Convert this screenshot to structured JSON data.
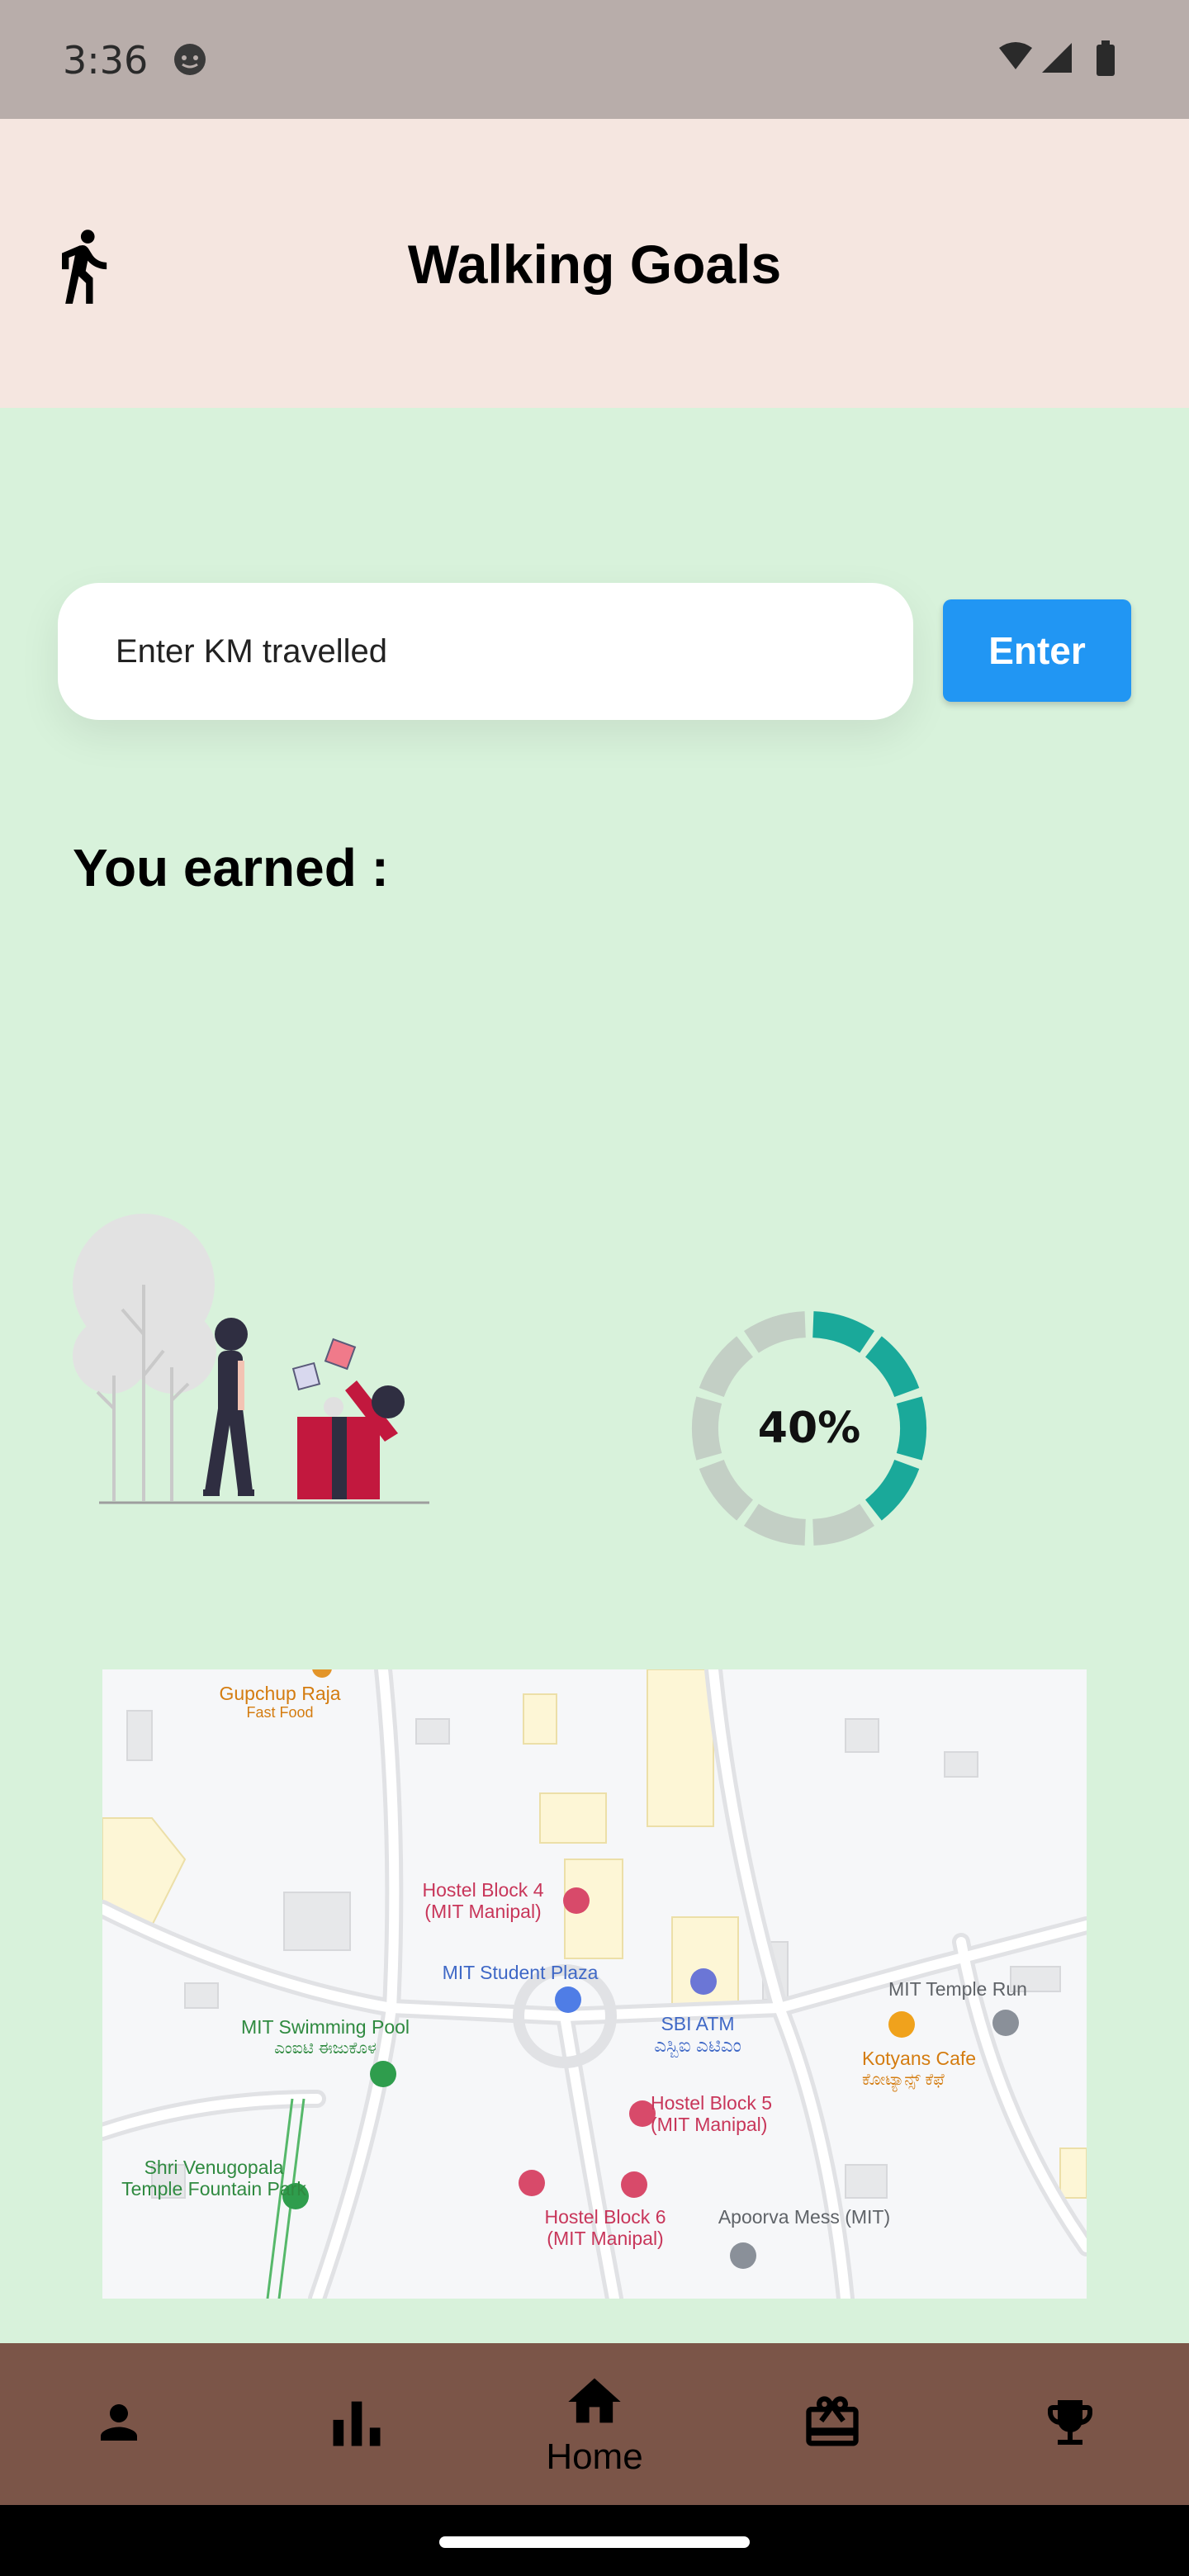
{
  "status_bar": {
    "time": "3:36"
  },
  "app_bar": {
    "title": "Walking Goals",
    "icon": "walking-icon"
  },
  "input": {
    "placeholder": "Enter KM travelled",
    "value": ""
  },
  "enter_button": {
    "label": "Enter"
  },
  "earned": {
    "label": "You earned :"
  },
  "progress": {
    "value": 0.4,
    "label": "40%",
    "active_color": "#1aa99a",
    "inactive_color": "#c3cfc5"
  },
  "map": {
    "pois": [
      {
        "name": "Gupchup Raja",
        "sub": "Fast Food"
      },
      {
        "name": "Hostel Block 4",
        "sub": "(MIT Manipal)"
      },
      {
        "name": "MIT Student Plaza",
        "sub": ""
      },
      {
        "name": "SBI ATM",
        "sub": "ಎಸ್ಬಿಐ ಎಟಿಎಂ"
      },
      {
        "name": "MIT Temple Run",
        "sub": ""
      },
      {
        "name": "MIT Swimming Pool",
        "sub": "ಎಂಐಟಿ ಈಜುಕೊಳ"
      },
      {
        "name": "Kotyans Cafe",
        "sub": "ಕೋಟ್ಯಾನ್ಸ್ ಕೆಫೆ"
      },
      {
        "name": "Hostel Block 5",
        "sub": "(MIT Manipal)"
      },
      {
        "name": "Shri Venugopala",
        "sub": "Temple Fountain Park"
      },
      {
        "name": "Hostel Block 6",
        "sub": "(MIT Manipal)"
      },
      {
        "name": "Apoorva Mess (MIT)",
        "sub": ""
      }
    ]
  },
  "bottom_nav": {
    "items": [
      {
        "icon": "person-icon",
        "label": ""
      },
      {
        "icon": "bar-chart-icon",
        "label": ""
      },
      {
        "icon": "home-icon",
        "label": "Home"
      },
      {
        "icon": "gift-card-icon",
        "label": ""
      },
      {
        "icon": "trophy-icon",
        "label": ""
      }
    ]
  },
  "colors": {
    "accent": "#2196f3",
    "content_bg": "#d8f2db",
    "app_bar_bg": "#f5e6e0",
    "nav_bg": "#7b5548"
  }
}
